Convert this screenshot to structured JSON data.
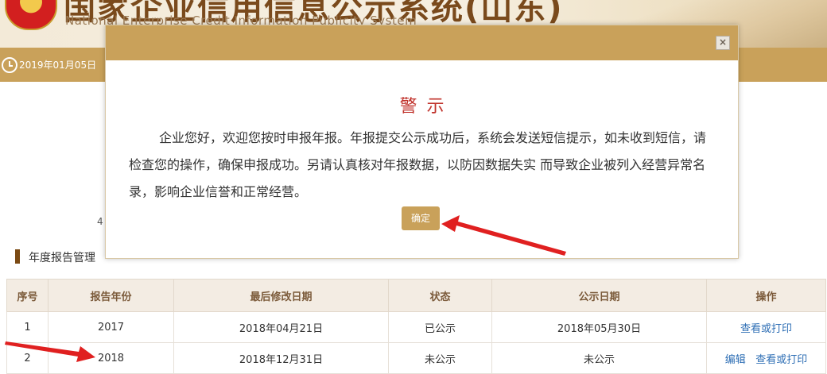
{
  "header": {
    "title": "国家企业信用信息公示系统(山东)",
    "subtitle": "National Enterprise Credit Information Publicity System"
  },
  "navbar": {
    "date": "2019年01月05日"
  },
  "section": {
    "title": "年度报告管理",
    "stray_char": "4"
  },
  "table": {
    "headers": [
      "序号",
      "报告年份",
      "最后修改日期",
      "状态",
      "公示日期",
      "操作"
    ],
    "rows": [
      {
        "no": "1",
        "year": "2017",
        "modified": "2018年04月21日",
        "status": "已公示",
        "publish_date": "2018年05月30日",
        "edit": "",
        "view": "查看或打印"
      },
      {
        "no": "2",
        "year": "2018",
        "modified": "2018年12月31日",
        "status": "未公示",
        "publish_date": "未公示",
        "edit": "编辑",
        "view": "查看或打印"
      }
    ]
  },
  "modal": {
    "close_symbol": "×",
    "title": "警示",
    "body": "企业您好，欢迎您按时申报年报。年报提交公示成功后，系统会发送短信提示，如未收到短信，请检查您的操作，确保申报成功。另请认真核对年报数据，以防因数据失实 而导致企业被列入经营异常名录，影响企业信誉和正常经营。",
    "ok_label": "确定"
  },
  "colors": {
    "gold": "#c9a15a",
    "warn_red": "#c0322b",
    "arrow_red": "#e02020",
    "link_blue": "#2f6fb5"
  }
}
